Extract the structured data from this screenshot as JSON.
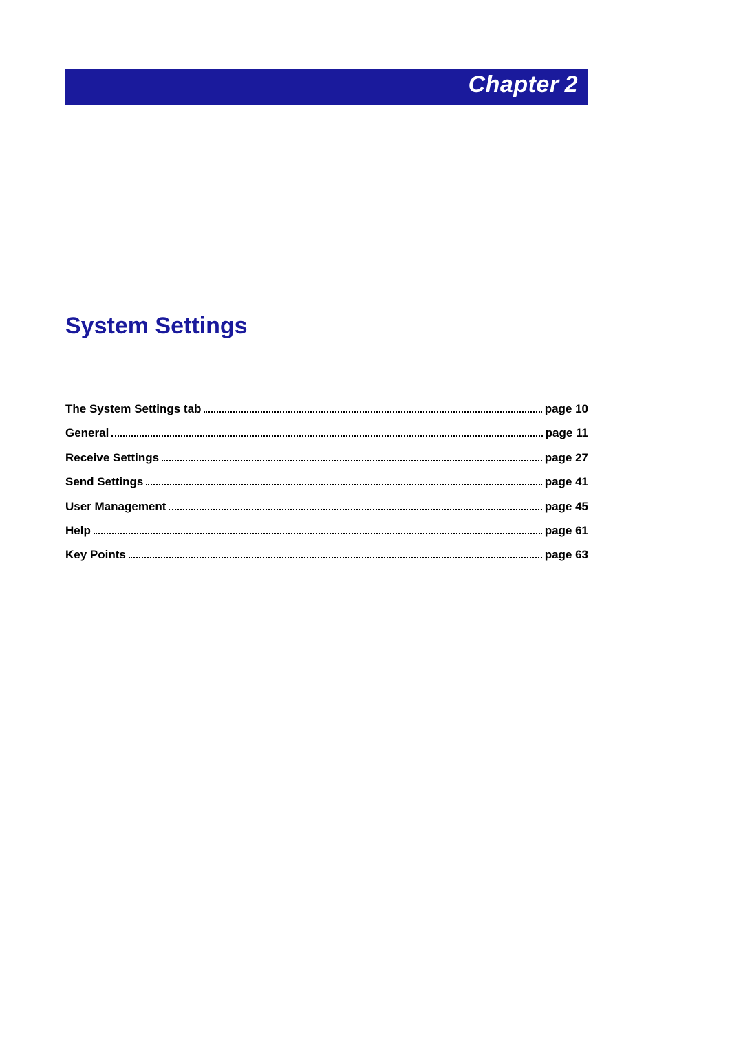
{
  "chapter": {
    "label": "Chapter",
    "number": "2"
  },
  "title": "System Settings",
  "toc": [
    {
      "label": "The System Settings tab",
      "page": "page 10"
    },
    {
      "label": "General",
      "page": "page 11"
    },
    {
      "label": "Receive Settings",
      "page": "page 27"
    },
    {
      "label": "Send Settings",
      "page": "page 41"
    },
    {
      "label": "User Management",
      "page": "page 45"
    },
    {
      "label": "Help",
      "page": "page 61"
    },
    {
      "label": "Key Points",
      "page": "page 63"
    }
  ]
}
